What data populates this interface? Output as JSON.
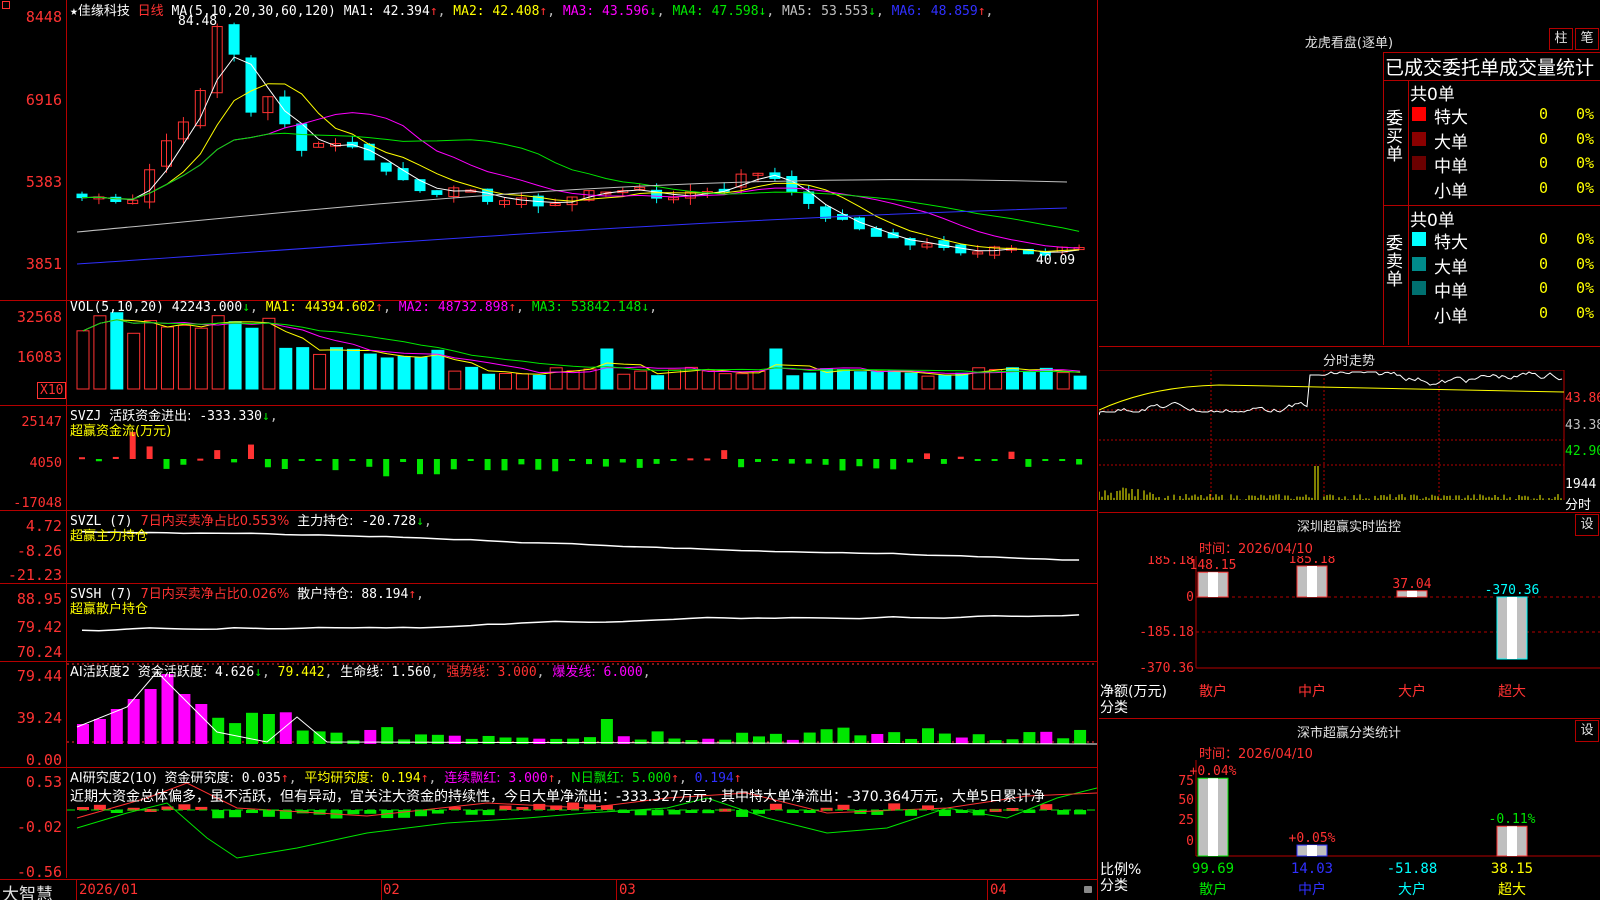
{
  "app": {
    "brand": "大智慧",
    "stock_name": "佳缘科技",
    "period": "日线",
    "star": "★"
  },
  "main_chart": {
    "legend_label": "MA(5,10,20,30,60,120)",
    "ma": [
      {
        "name": "MA1",
        "value": "42.394",
        "arrow": "↑",
        "color": "#ffffff"
      },
      {
        "name": "MA2",
        "value": "42.408",
        "arrow": "↑",
        "color": "#ffff00"
      },
      {
        "name": "MA3",
        "value": "43.596",
        "arrow": "↓",
        "color": "#ff00ff"
      },
      {
        "name": "MA4",
        "value": "47.598",
        "arrow": "↓",
        "color": "#00e600"
      },
      {
        "name": "MA5",
        "value": "53.553",
        "arrow": "↓",
        "color": "#c0c0c0"
      },
      {
        "name": "MA6",
        "value": "48.859",
        "arrow": "↑",
        "color": "#3030ff"
      }
    ],
    "y_labels": [
      "8448",
      "6916",
      "5383",
      "3851"
    ],
    "high_mark": "84.48",
    "low_mark": "40.09"
  },
  "vol_chart": {
    "legend_label": "VOL(5,10,20)",
    "value": "42243.000",
    "value_arrow": "↓",
    "ma": [
      {
        "name": "MA1",
        "value": "44394.602",
        "arrow": "↑",
        "color": "#ffff00"
      },
      {
        "name": "MA2",
        "value": "48732.898",
        "arrow": "↑",
        "color": "#ff00ff"
      },
      {
        "name": "MA3",
        "value": "53842.148",
        "arrow": "↓",
        "color": "#00e600"
      }
    ],
    "y_labels": [
      "32568",
      "16083"
    ],
    "unit": "X10"
  },
  "svzj_chart": {
    "legend_label": "SVZJ",
    "field": "活跃资金进出:",
    "value": "-333.330",
    "arrow": "↓",
    "subtitle": "超赢资金流(万元)",
    "y_labels": [
      "25147",
      "4050",
      "-17048"
    ]
  },
  "svzl_chart": {
    "legend_label": "SVZL (7)",
    "field1": "7日内买卖净占比0.553%",
    "field2": "主力持仓:",
    "value": "-20.728",
    "arrow": "↓",
    "subtitle": "超赢主力持仓",
    "y_labels": [
      "4.72",
      "-8.26",
      "-21.23"
    ]
  },
  "svsh_chart": {
    "legend_label": "SVSH (7)",
    "field1": "7日内买卖净占比0.026%",
    "field2": "散户持仓:",
    "value": "88.194",
    "arrow": "↑",
    "subtitle": "超赢散户持仓",
    "y_labels": [
      "88.95",
      "79.42",
      "70.24"
    ]
  },
  "ai_active": {
    "legend_label": "AI活跃度2",
    "field1": "资金活跃度:",
    "value1": "4.626",
    "arrow1": "↓",
    "value2": "79.442",
    "field3": "生命线:",
    "value3": "1.560",
    "field4": "强势线:",
    "value4": "3.000",
    "field5": "爆发线:",
    "value5": "6.000",
    "y_labels": [
      "79.44",
      "39.24",
      "0.00"
    ]
  },
  "ai_research": {
    "legend_label": "AI研究度2(10)",
    "field1": "资金研究度:",
    "value1": "0.035",
    "arrow1": "↑",
    "field2": "平均研究度:",
    "value2": "0.194",
    "arrow2": "↑",
    "field3": "连续飘红:",
    "value3": "3.000",
    "arrow3": "↑",
    "field4": "N日飘红:",
    "value4": "5.000",
    "arrow4": "↑",
    "value5": "0.194",
    "arrow5": "↑",
    "commentary": "近期大资金总体偏多，虽不活跃，但有异动，宜关注大资金的持续性，今日大单净流出：-333.327万元，其中特大单净流出：-370.364万元，大单5日累计净",
    "y_labels": [
      "0.53",
      "-0.02",
      "-0.56"
    ]
  },
  "x_axis": {
    "labels": [
      "2026/01",
      "02",
      "03",
      "04"
    ]
  },
  "longhu": {
    "title": "龙虎看盘(逐单)",
    "btn_bar": "柱",
    "btn_pen": "笔",
    "header": "已成交委托单成交量统计",
    "buy": {
      "side_label": "委买单",
      "total": "共0单",
      "rows": [
        {
          "label": "特大",
          "count": "0",
          "pct": "0%",
          "color": "#ff0000"
        },
        {
          "label": "大单",
          "count": "0",
          "pct": "0%",
          "color": "#8b0000"
        },
        {
          "label": "中单",
          "count": "0",
          "pct": "0%",
          "color": "#6b0000"
        },
        {
          "label": "小单",
          "count": "0",
          "pct": "0%",
          "color": ""
        }
      ]
    },
    "sell": {
      "side_label": "委卖单",
      "total": "共0单",
      "rows": [
        {
          "label": "特大",
          "count": "0",
          "pct": "0%",
          "color": "#00ffff"
        },
        {
          "label": "大单",
          "count": "0",
          "pct": "0%",
          "color": "#008b8b"
        },
        {
          "label": "中单",
          "count": "0",
          "pct": "0%",
          "color": "#007070"
        },
        {
          "label": "小单",
          "count": "0",
          "pct": "0%",
          "color": ""
        }
      ]
    }
  },
  "intraday": {
    "title": "分时走势",
    "y_labels": [
      "43.86",
      "43.38",
      "42.90"
    ],
    "vol_labels": [
      "1944",
      "分时"
    ]
  },
  "sz_monitor": {
    "title": "深圳超赢实时监控",
    "btn": "设",
    "time_label": "时间：2026/04/10",
    "y_labels": [
      "185.18",
      "0",
      "-185.18",
      "-370.36"
    ],
    "unit_label": "净额(万元)",
    "cat_label": "分类",
    "categories": [
      "散户",
      "中户",
      "大户",
      "超大"
    ],
    "values": [
      148.15,
      185.18,
      37.04,
      -370.36
    ],
    "value_labels": [
      "148.15",
      "185.18",
      "37.04",
      "-370.36"
    ]
  },
  "sz_classify": {
    "title": "深市超赢分类统计",
    "btn": "设",
    "time_label": "时间：2026/04/10",
    "y_labels": [
      "75",
      "50",
      "25",
      "0"
    ],
    "ratio_label": "比例%",
    "cat_label": "分类",
    "categories": [
      "散户",
      "中户",
      "大户",
      "超大"
    ],
    "change_labels": [
      "+0.04%",
      "+0.05%",
      "",
      "-0.11%"
    ],
    "values": [
      "99.69",
      "14.03",
      "-51.88",
      "38.15"
    ],
    "value_colors": [
      "#00e600",
      "#3030ff",
      "#00ffff",
      "#ffff00"
    ]
  },
  "chart_data": {
    "type": "bar",
    "title": "深圳超赢实时监控",
    "categories": [
      "散户",
      "中户",
      "大户",
      "超大"
    ],
    "values": [
      148.15,
      185.18,
      37.04,
      -370.36
    ],
    "ylabel": "净额(万元)",
    "ylim": [
      -370.36,
      185.18
    ]
  }
}
